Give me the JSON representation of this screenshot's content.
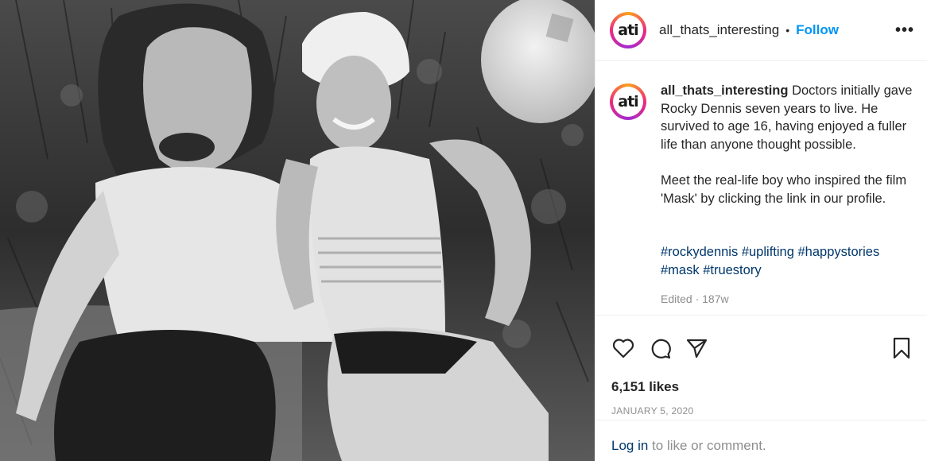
{
  "post": {
    "photo_alt": "Black-and-white photo of a boy and a woman in a white cap sitting together outdoors",
    "account": {
      "avatar_text": "ati",
      "username": "all_thats_interesting",
      "separator": "•",
      "follow_label": "Follow",
      "more_label": "•••"
    },
    "caption": {
      "username": "all_thats_interesting",
      "paragraph1": "Doctors initially gave Rocky Dennis seven years to live. He survived to age 16, having enjoyed a fuller life than anyone thought possible.",
      "paragraph2": "Meet the real-life boy who inspired the film 'Mask' by clicking the link in our profile.",
      "hashtags": [
        "#rockydennis",
        "#uplifting",
        "#happystories",
        "#mask",
        "#truestory"
      ],
      "cut_line": "Edited · 187w"
    },
    "actions": {
      "like_icon": "heart-icon",
      "comment_icon": "comment-icon",
      "share_icon": "share-icon",
      "save_icon": "bookmark-icon"
    },
    "likes": "6,151 likes",
    "date": "JANUARY 5, 2020",
    "login": {
      "link": "Log in",
      "rest": " to like or comment."
    },
    "colors": {
      "follow": "#0095f6",
      "hashtag": "#00376b",
      "muted": "#8e8e8e",
      "text": "#262626"
    }
  }
}
